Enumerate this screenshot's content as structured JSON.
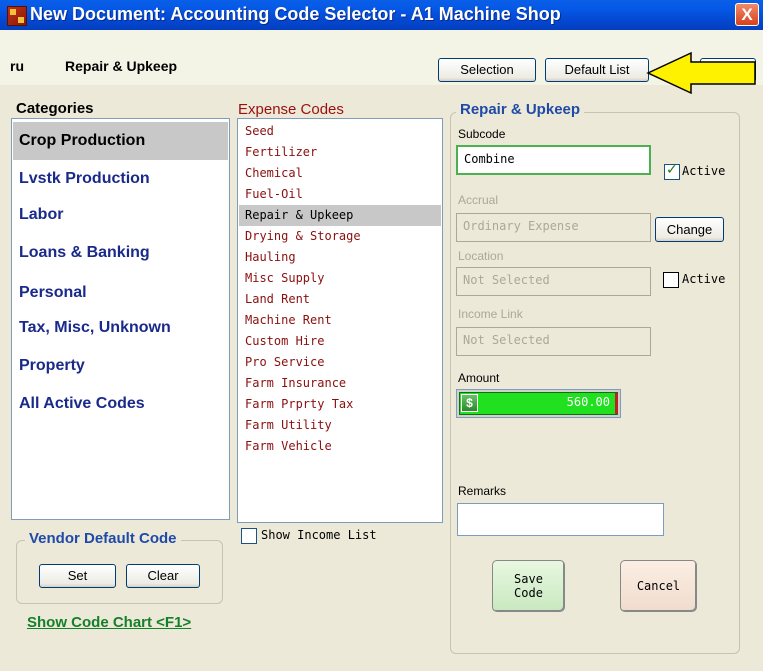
{
  "window": {
    "title": "New Document: Accounting Code Selector - A1 Machine Shop",
    "close_label": "X"
  },
  "header": {
    "code": "ru",
    "category": "Repair & Upkeep",
    "selection_button": "Selection",
    "default_list_button": "Default List"
  },
  "categories": {
    "title": "Categories",
    "items": [
      "Crop Production",
      "Lvstk Production",
      "Labor",
      "Loans & Banking",
      "Personal",
      "Tax, Misc, Unknown",
      "Property",
      "All Active Codes"
    ],
    "selected": "Crop Production"
  },
  "expense_codes": {
    "title": "Expense Codes",
    "items": [
      "Seed",
      "Fertilizer",
      "Chemical",
      "Fuel-Oil",
      "Repair & Upkeep",
      "Drying & Storage",
      "Hauling",
      "Misc Supply",
      "Land Rent",
      "Machine Rent",
      "Custom Hire",
      "Pro Service",
      "Farm Insurance",
      "Farm Prprty Tax",
      "Farm Utility",
      "Farm Vehicle"
    ],
    "selected": "Repair & Upkeep",
    "show_income_label": "Show Income List",
    "show_income_checked": false
  },
  "detail": {
    "title": "Repair & Upkeep",
    "subcode_label": "Subcode",
    "subcode_value": "Combine",
    "active_label": "Active",
    "active_checked": true,
    "accrual_label": "Accrual",
    "accrual_value": "Ordinary Expense",
    "change_button": "Change",
    "location_label": "Location",
    "location_value": "Not Selected",
    "location_active_label": "Active",
    "location_active_checked": false,
    "income_link_label": "Income Link",
    "income_link_value": "Not Selected",
    "amount_label": "Amount",
    "amount_value": "560.00",
    "amount_icon": "dollar-icon",
    "remarks_label": "Remarks",
    "remarks_value": "",
    "save_button_line1": "Save",
    "save_button_line2": "Code",
    "cancel_button": "Cancel"
  },
  "vendor_default": {
    "title": "Vendor Default Code",
    "set_button": "Set",
    "clear_button": "Clear"
  },
  "show_code_chart": "Show Code Chart <F1>",
  "colors": {
    "title_bar": "#0558E6",
    "category_text": "#1a2a8a",
    "expense_text": "#8a0f0f",
    "group_title": "#1f4aa8",
    "link_green": "#15802a",
    "amount_green": "#20e020",
    "callout_arrow": "#FFF200"
  }
}
